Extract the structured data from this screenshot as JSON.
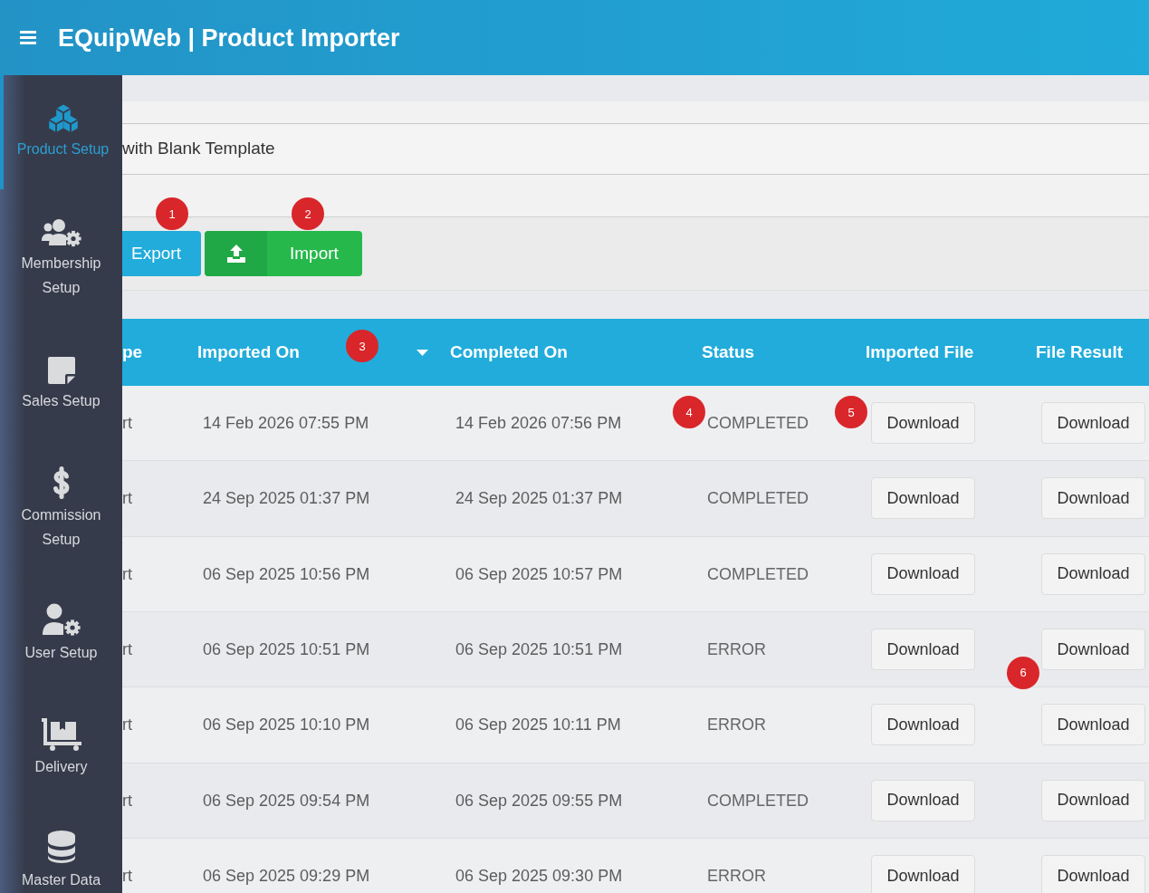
{
  "header": {
    "title": "EQuipWeb | Product Importer"
  },
  "sidebar": {
    "items": [
      {
        "label": "Product Setup",
        "selected": true
      },
      {
        "label": "Membership Setup",
        "selected": false
      },
      {
        "label": "Sales Setup",
        "selected": false
      },
      {
        "label": "Commission Setup",
        "selected": false
      },
      {
        "label": "User Setup",
        "selected": false
      },
      {
        "label": "Delivery",
        "selected": false
      },
      {
        "label": "Master Data",
        "selected": false
      }
    ]
  },
  "template_option": {
    "label": "with Blank Template"
  },
  "toolbar": {
    "buttons": [
      {
        "kind": "export",
        "label": "Export",
        "marker": "1"
      },
      {
        "kind": "import",
        "label": "Import",
        "marker": "2"
      }
    ]
  },
  "table": {
    "columns": [
      {
        "label": "pe",
        "sorted": false
      },
      {
        "label": "Imported On",
        "sorted": true,
        "marker": "3"
      },
      {
        "label": "Completed On",
        "sorted": false
      },
      {
        "label": "Status",
        "sorted": false
      },
      {
        "label": "Imported File",
        "sorted": false
      },
      {
        "label": "File Result",
        "sorted": false
      }
    ],
    "rows": [
      {
        "cells": [
          {
            "kind": "text",
            "text": "rt"
          },
          {
            "kind": "text",
            "text": "14 Feb 2026 07:55 PM"
          },
          {
            "kind": "text",
            "text": "14 Feb 2026 07:56 PM"
          },
          {
            "kind": "text",
            "text": "COMPLETED",
            "marker": "4"
          },
          {
            "kind": "button",
            "text": "Download",
            "marker": "5"
          },
          {
            "kind": "button",
            "text": "Download"
          }
        ]
      },
      {
        "cells": [
          {
            "kind": "text",
            "text": "rt"
          },
          {
            "kind": "text",
            "text": "24 Sep 2025 01:37 PM"
          },
          {
            "kind": "text",
            "text": "24 Sep 2025 01:37 PM"
          },
          {
            "kind": "text",
            "text": "COMPLETED"
          },
          {
            "kind": "button",
            "text": "Download"
          },
          {
            "kind": "button",
            "text": "Download"
          }
        ]
      },
      {
        "cells": [
          {
            "kind": "text",
            "text": "rt"
          },
          {
            "kind": "text",
            "text": "06 Sep 2025 10:56 PM"
          },
          {
            "kind": "text",
            "text": "06 Sep 2025 10:57 PM"
          },
          {
            "kind": "text",
            "text": "COMPLETED"
          },
          {
            "kind": "button",
            "text": "Download"
          },
          {
            "kind": "button",
            "text": "Download"
          }
        ]
      },
      {
        "cells": [
          {
            "kind": "text",
            "text": "rt"
          },
          {
            "kind": "text",
            "text": "06 Sep 2025 10:51 PM"
          },
          {
            "kind": "text",
            "text": "06 Sep 2025 10:51 PM"
          },
          {
            "kind": "text",
            "text": "ERROR"
          },
          {
            "kind": "button",
            "text": "Download"
          },
          {
            "kind": "button",
            "text": "Download",
            "marker": "6"
          }
        ]
      },
      {
        "cells": [
          {
            "kind": "text",
            "text": "rt"
          },
          {
            "kind": "text",
            "text": "06 Sep 2025 10:10 PM"
          },
          {
            "kind": "text",
            "text": "06 Sep 2025 10:11 PM"
          },
          {
            "kind": "text",
            "text": "ERROR"
          },
          {
            "kind": "button",
            "text": "Download"
          },
          {
            "kind": "button",
            "text": "Download"
          }
        ]
      },
      {
        "cells": [
          {
            "kind": "text",
            "text": "rt"
          },
          {
            "kind": "text",
            "text": "06 Sep 2025 09:54 PM"
          },
          {
            "kind": "text",
            "text": "06 Sep 2025 09:55 PM"
          },
          {
            "kind": "text",
            "text": "COMPLETED"
          },
          {
            "kind": "button",
            "text": "Download"
          },
          {
            "kind": "button",
            "text": "Download"
          }
        ]
      },
      {
        "cells": [
          {
            "kind": "text",
            "text": "rt"
          },
          {
            "kind": "text",
            "text": "06 Sep 2025 09:29 PM"
          },
          {
            "kind": "text",
            "text": "06 Sep 2025 09:30 PM"
          },
          {
            "kind": "text",
            "text": "ERROR"
          },
          {
            "kind": "button",
            "text": "Download"
          },
          {
            "kind": "button",
            "text": "Download"
          }
        ]
      }
    ]
  }
}
